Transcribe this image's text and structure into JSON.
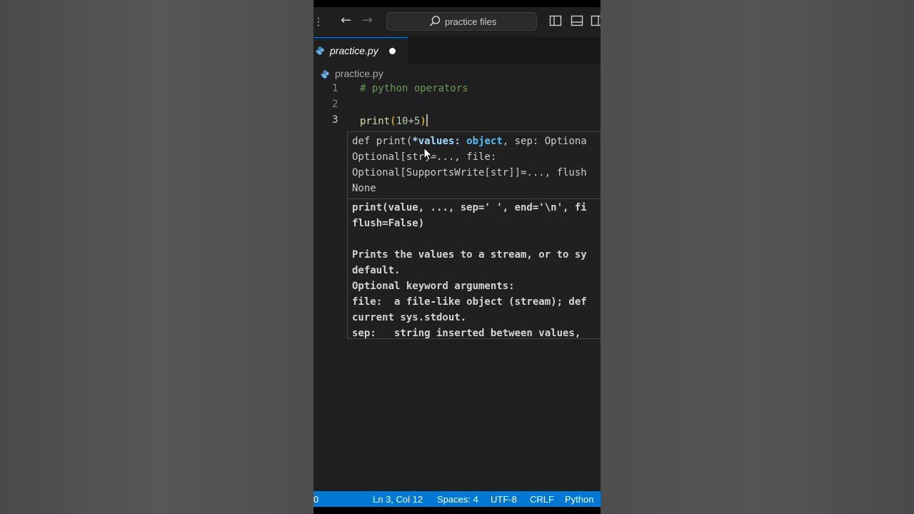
{
  "titlebar": {
    "search_text": "practice files",
    "icons": [
      "menu-dots-icon",
      "arrow-left-icon",
      "arrow-right-icon",
      "search-icon",
      "toggle-primary-sidebar-icon",
      "toggle-panel-icon",
      "toggle-secondary-sidebar-icon"
    ]
  },
  "tab": {
    "label": "practice.py",
    "modified": true
  },
  "breadcrumb": {
    "file": "practice.py"
  },
  "editor": {
    "lines": [
      {
        "number": "1",
        "text": "# python operators"
      },
      {
        "number": "2",
        "text": ""
      },
      {
        "number": "3",
        "fn": "print",
        "open": "(",
        "arg": "10+5",
        "close": ")"
      }
    ]
  },
  "hover": {
    "signature": [
      {
        "pre": "def print(",
        "param": "*values",
        "colon": ": ",
        "type": "object",
        "post": ", sep: Optiona"
      },
      {
        "text": "Optional[str]=..., file:"
      },
      {
        "text": "Optional[SupportsWrite[str]]=..., flush"
      },
      {
        "text": "None"
      }
    ],
    "doc": [
      "print(value, ..., sep=' ', end='\\n', fi",
      "flush=False)",
      "",
      "Prints the values to a stream, or to sy",
      "default.",
      "Optional keyword arguments:",
      "file:  a file-like object (stream); def",
      "current sys.stdout.",
      "sep:   string inserted between values,"
    ]
  },
  "statusbar": {
    "left": "0",
    "position": "Ln 3, Col 12",
    "spaces": "Spaces: 4",
    "encoding": "UTF-8",
    "eol": "CRLF",
    "language": "Python"
  },
  "colors": {
    "accent": "#0078d4",
    "editor_bg": "#1f1f1f",
    "comment": "#6a9955",
    "function": "#dcdcaa",
    "bracket": "#ffd700",
    "number": "#b5cea8"
  }
}
